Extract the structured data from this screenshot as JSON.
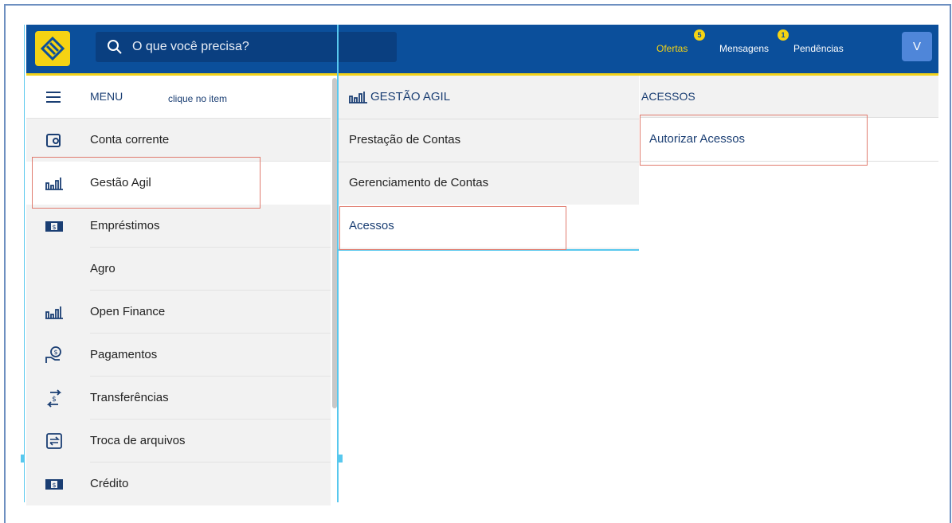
{
  "header": {
    "search_placeholder": "O que você precisa?",
    "nav": [
      {
        "label": "Ofertas",
        "badge": "5",
        "color": "#f5d313"
      },
      {
        "label": "Mensagens",
        "badge": "",
        "color": "#ffffff"
      },
      {
        "label": "Pendências",
        "badge": "1",
        "color": "#ffffff"
      }
    ],
    "avatar": "V"
  },
  "menu": {
    "title": "MENU",
    "hint": "clique no item",
    "items": [
      {
        "label": "Conta corrente",
        "icon": "wallet-icon"
      },
      {
        "label": "Gestão Agil",
        "icon": "bar-chart-icon"
      },
      {
        "label": "Empréstimos",
        "icon": "money-icon"
      },
      {
        "label": "Agro",
        "icon": ""
      },
      {
        "label": "Open Finance",
        "icon": "bar-chart-icon"
      },
      {
        "label": "Pagamentos",
        "icon": "hand-coin-icon"
      },
      {
        "label": "Transferências",
        "icon": "transfer-icon"
      },
      {
        "label": "Troca de arquivos",
        "icon": "exchange-icon"
      },
      {
        "label": "Crédito",
        "icon": "money-icon"
      }
    ]
  },
  "gestao": {
    "title": "GESTÃO AGIL",
    "items": [
      "Prestação de Contas",
      "Gerenciamento de Contas",
      "Acessos"
    ]
  },
  "acessos": {
    "title": "ACESSOS",
    "items": [
      "Autorizar Acessos"
    ]
  },
  "colors": {
    "brand_blue": "#0b4f9b",
    "brand_yellow": "#f5d313",
    "highlight": "#e07b6e"
  }
}
